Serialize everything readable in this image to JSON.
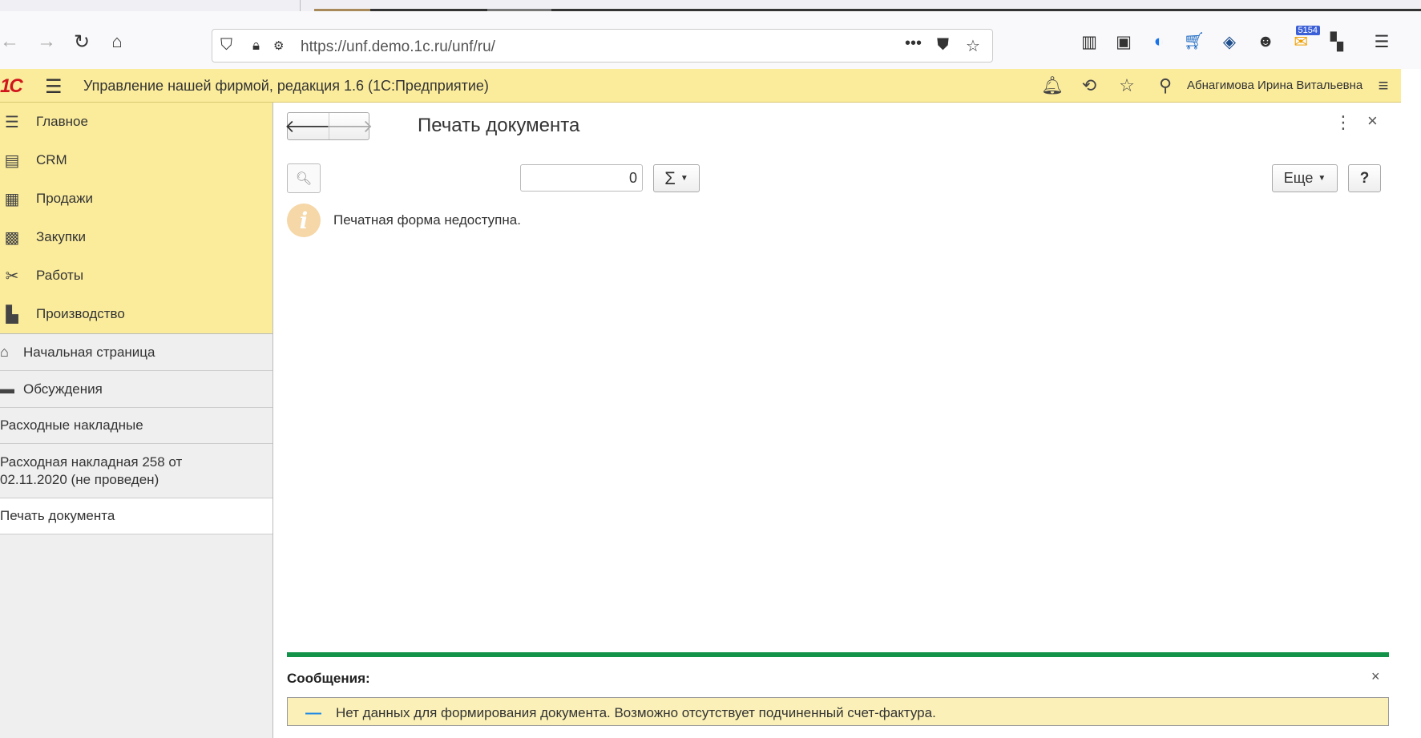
{
  "browser": {
    "url": "https://unf.demo.1c.ru/unf/ru/",
    "badge_count": "5154",
    "icons": [
      "back-arrow",
      "forward-arrow",
      "reload",
      "home",
      "shield",
      "lock",
      "more-dots",
      "pocket",
      "star",
      "library",
      "reader",
      "cloud",
      "cart",
      "layers",
      "account",
      "mail",
      "extensions",
      "menu"
    ]
  },
  "header": {
    "logo": "1С",
    "title": "Управление нашей фирмой, редакция 1.6  (1С:Предприятие)",
    "user": "Абнагимова Ирина Витальевна"
  },
  "sidebar": {
    "sections": [
      {
        "label": "Главное",
        "icon": "menu-icon"
      },
      {
        "label": "CRM",
        "icon": "contacts-icon"
      },
      {
        "label": "Продажи",
        "icon": "basket-icon"
      },
      {
        "label": "Закупки",
        "icon": "cart-icon"
      },
      {
        "label": "Работы",
        "icon": "tools-icon"
      },
      {
        "label": "Производство",
        "icon": "factory-icon"
      }
    ],
    "nav": [
      {
        "label": "Начальная страница"
      },
      {
        "label": "Обсуждения"
      },
      {
        "label": "Расходные накладные"
      },
      {
        "label": "Расходная накладная 258 от 02.11.2020 (не проведен)"
      },
      {
        "label": "Печать документа"
      }
    ]
  },
  "form": {
    "title": "Печать документа",
    "copies_value": "0",
    "sum_symbol": "Σ",
    "more_label": "Еще",
    "help_label": "?",
    "info_text": "Печатная форма недоступна."
  },
  "messages": {
    "title": "Сообщения:",
    "items": [
      {
        "text": "Нет данных для формирования документа. Возможно отсутствует подчиненный счет-фактура."
      }
    ]
  },
  "colors": {
    "header_bg": "#fbec9c",
    "logo_red": "#d0161b",
    "message_bar": "#13934a",
    "message_bg": "#fbf1b8"
  }
}
